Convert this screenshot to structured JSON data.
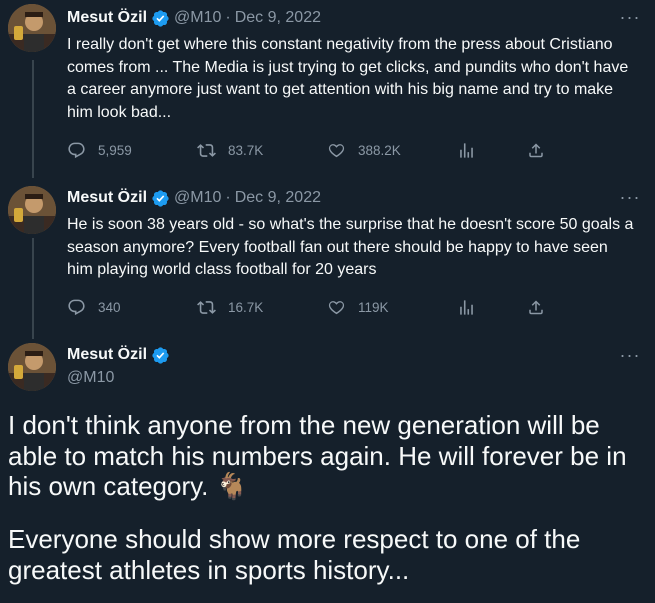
{
  "tweets": [
    {
      "name": "Mesut Özil",
      "handle": "@M10",
      "separator": "·",
      "date": "Dec 9, 2022",
      "text": "I really don't get where this constant negativity from the press about Cristiano comes from ... The Media is just trying to get clicks, and pundits who don't have a career anymore just want to get attention with his big name and try to make him look bad...",
      "replies": "5,959",
      "retweets": "83.7K",
      "likes": "388.2K"
    },
    {
      "name": "Mesut Özil",
      "handle": "@M10",
      "separator": "·",
      "date": "Dec 9, 2022",
      "text": "He is soon 38 years old - so what's the surprise that he doesn't score 50 goals a season anymore? Every football fan out there should be happy to have seen him playing world class football for 20 years",
      "replies": "340",
      "retweets": "16.7K",
      "likes": "119K"
    }
  ],
  "main_tweet": {
    "name": "Mesut Özil",
    "handle": "@M10",
    "paragraph1": "I don't think anyone from the new generation will be able to match his numbers again. He will forever be in his own category. 🐐",
    "paragraph2": "Everyone should show more respect to one of the greatest athletes in sports history..."
  },
  "icons": [
    "verified-badge-icon",
    "more-icon",
    "reply-icon",
    "retweet-icon",
    "like-icon",
    "views-icon",
    "share-icon"
  ],
  "colors": {
    "background": "#15202b",
    "text": "#f7f9f9",
    "muted": "#8b98a5",
    "verified": "#1d9bf0"
  },
  "more_glyph": "···"
}
